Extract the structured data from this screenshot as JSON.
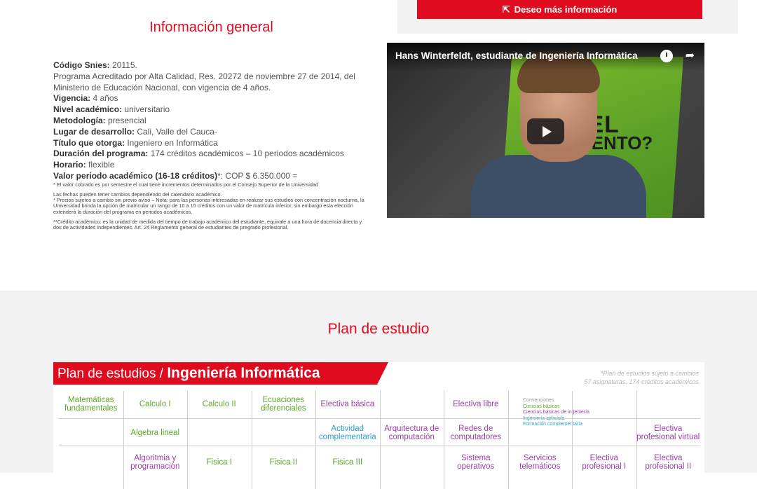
{
  "cta": {
    "label": "Deseo más información",
    "icon": "external-link-icon"
  },
  "info": {
    "title": "Información general",
    "snies_label": "Código Snies:",
    "snies_value": "20115.",
    "accreditation": "Programa Acreditado por Alta Calidad, Res. 20272 de noviembre 27 de 2014, del Ministerio de Educación Nacional, con vigencia de 4 años.",
    "vigencia_label": "Vigencia:",
    "vigencia_value": "4 años",
    "nivel_label": "Nivel académico:",
    "nivel_value": "universitario",
    "metodologia_label": "Metodología:",
    "metodologia_value": "presencial",
    "lugar_label": "Lugar de desarrollo:",
    "lugar_value": "Cali, Valle del Cauca-",
    "titulo_label": "Título que otorga:",
    "titulo_value": "Ingeniero en Informática",
    "duracion_label": "Duración del programa:",
    "duracion_value": "174 créditos académicos – 10 periodos académicos",
    "horario_label": "Horario:",
    "horario_value": "flexible",
    "valor_label": "Valor periodo académico (16-18 créditos)",
    "valor_value": "*: COP $ 6.350.000 =",
    "note1": "* El valor cobrado es por semestre el cual tiene incrementos determinados por el Consejo Superior de la Universidad",
    "note2": "Las fechas pueden tener cambios dependiendo del calendario académico.",
    "note3": "* Precios sujetos a cambio sin previo aviso – Nota: para las personas interesadas en realizar sus estudios con concentración nocturna, la Universidad brinda la opción de matricular un rango de 10 a 15 créditos con un valor de matrícula inferior, sin embargo esta elección extenderá la duración del programa en periodos académicos.",
    "note4": "**Crédito académico: es la unidad de medida del tiempo de trabajo académico del estudiante, equivale a una hora de docencia directa y dos de actividades independientes. Art. 24 Reglamento general de estudiantes de pregrado profesional."
  },
  "video": {
    "title": "Hans Winterfeldt, estudiante de Ingeniería Informática",
    "poster_line1": "VES EL",
    "poster_line2": "MENTO?"
  },
  "plan": {
    "title": "Plan de estudio",
    "banner_prefix": "Plan de estudios / ",
    "banner_program": "Ingeniería Informática",
    "note_line1": "*Plan de estudios sujeto a cambios",
    "note_line2": "57 asignaturas, 174 créditos académicos",
    "legend_title": "Convenciones",
    "legend_1": "Ciencias básicas",
    "legend_2": "Ciencias básicas de ingeniería",
    "legend_3": "Ingeniería aplicada",
    "legend_4": "Formación complementaria",
    "row1": [
      "Matemáticas fundamentales",
      "Calculo I",
      "Calculo II",
      "Ecuaciones diferenciales",
      "Electiva básica",
      "",
      "Electiva libre"
    ],
    "row2": [
      "",
      "Algebra lineal",
      "",
      "",
      "Actividad complementaria",
      "Arquitectura de computación",
      "Redes de computadores",
      "",
      "",
      "Electiva profesional virtual"
    ],
    "row3": [
      "",
      "Algoritmia y programación",
      "Fisica I",
      "Fisica II",
      "Fisica III",
      "",
      "Sistema operativos",
      "Servicios telemáticos",
      "Electiva profesional I",
      "Electiva profesional II"
    ]
  }
}
